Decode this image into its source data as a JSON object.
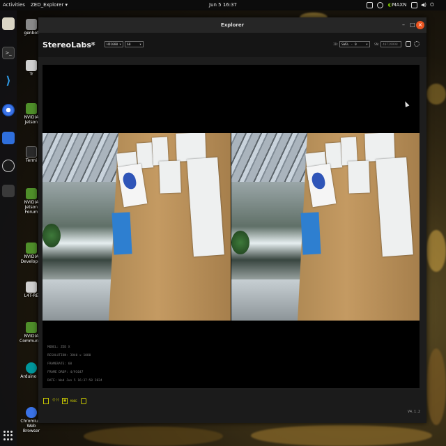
{
  "topbar": {
    "activities": "Activities",
    "app_menu": "ZED_Explorer",
    "clock": "Jun 5  16:37",
    "tray_label": "MAXN"
  },
  "desktop_icons": [
    {
      "label": "genbot",
      "color": "#8a8a8a"
    },
    {
      "label": "Tr",
      "color": "#cfcfcf"
    },
    {
      "label": "NVIDIA Jetson",
      "color": "#4f8f2a"
    },
    {
      "label": "Termi",
      "color": "#2a2a2a"
    },
    {
      "label": "NVIDIA Jetson Forum",
      "color": "#4f8f2a"
    },
    {
      "label": "NVIDIA Developer",
      "color": "#4f8f2a"
    },
    {
      "label": "L4T-RE",
      "color": "#cfcfcf"
    },
    {
      "label": "NVIDIA Community",
      "color": "#4f8f2a"
    },
    {
      "label": "Arduino ID",
      "color": "#00979c"
    },
    {
      "label": "Chromium Web Browser",
      "color": "#3b73e8"
    }
  ],
  "window": {
    "title": "Explorer",
    "minimize": "–",
    "maximize": "□",
    "close": "×"
  },
  "header": {
    "brand": "StereoLabs*",
    "live_label": "LIVE",
    "resolution_value": "HD1080",
    "fps_value": "60",
    "id_label": "ID:",
    "id_value": "SWEL - 0",
    "sn_label": "SN:",
    "sn_value": "40729998"
  },
  "info": {
    "model": "MODEL: ZED X",
    "resolution": "RESOLUTION: 3840 x 1080",
    "framerate": "FRAMERATE: 60",
    "frame_drop": "FRAME DROP: 4/91647",
    "date": "DATE: Wed Jun 5 16:37:58 2024"
  },
  "toolbar": {
    "mode_label": "MODE",
    "version": "V4.1.2"
  },
  "colors": {
    "accent": "#c7c700",
    "ubuntu_orange": "#e95420"
  }
}
